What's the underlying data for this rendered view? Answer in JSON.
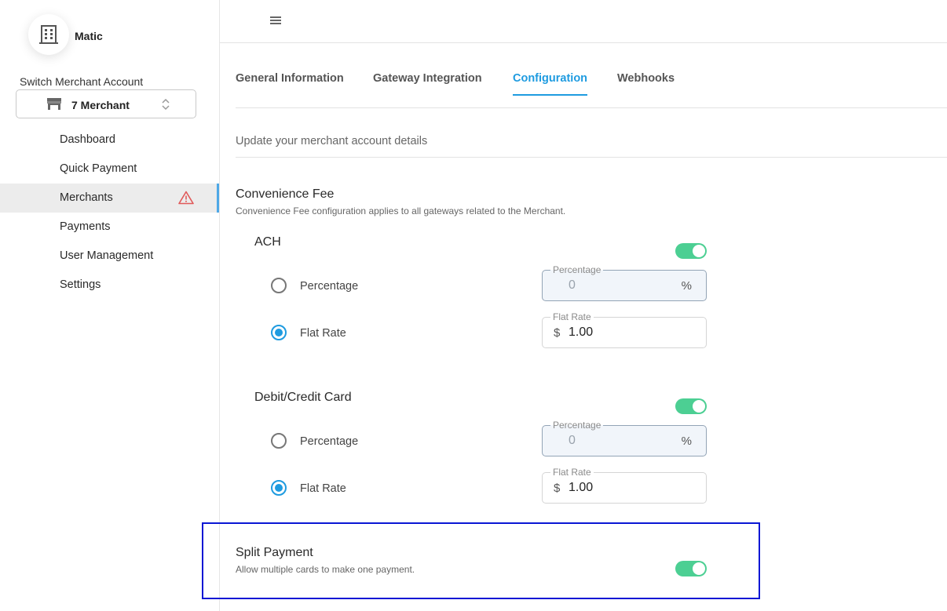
{
  "brand": {
    "name": "Matic",
    "logo_icon": "building-icon"
  },
  "merchant_switch": {
    "label": "Switch Merchant Account",
    "selected": "7 Merchant"
  },
  "sidebar": {
    "items": [
      {
        "label": "Dashboard"
      },
      {
        "label": "Quick Payment"
      },
      {
        "label": "Merchants",
        "active": true,
        "alert_icon": "warning-icon"
      },
      {
        "label": "Payments"
      },
      {
        "label": "User Management"
      },
      {
        "label": "Settings"
      }
    ]
  },
  "tabs": [
    {
      "label": "General Information"
    },
    {
      "label": "Gateway Integration"
    },
    {
      "label": "Configuration",
      "active": true
    },
    {
      "label": "Webhooks"
    }
  ],
  "subtitle": "Update your merchant account details",
  "convenience_fee": {
    "title": "Convenience Fee",
    "description": "Convenience Fee configuration applies to all gateways related to the Merchant.",
    "ach": {
      "title": "ACH",
      "enabled": true,
      "percentage_label": "Percentage",
      "flat_rate_label": "Flat Rate",
      "selected": "flat_rate",
      "percentage_field": {
        "label": "Percentage",
        "value": "0",
        "suffix": "%"
      },
      "flat_rate_field": {
        "label": "Flat Rate",
        "prefix": "$",
        "value": "1.00"
      }
    },
    "card": {
      "title": "Debit/Credit Card",
      "enabled": true,
      "percentage_label": "Percentage",
      "flat_rate_label": "Flat Rate",
      "selected": "flat_rate",
      "percentage_field": {
        "label": "Percentage",
        "value": "0",
        "suffix": "%"
      },
      "flat_rate_field": {
        "label": "Flat Rate",
        "prefix": "$",
        "value": "1.00"
      }
    }
  },
  "split_payment": {
    "title": "Split Payment",
    "description": "Allow multiple cards to make one payment.",
    "enabled": true
  },
  "colors": {
    "accent": "#1e9be0",
    "toggle_on": "#4ccf93",
    "highlight": "#0a17d4",
    "warning": "#e05a5a"
  }
}
